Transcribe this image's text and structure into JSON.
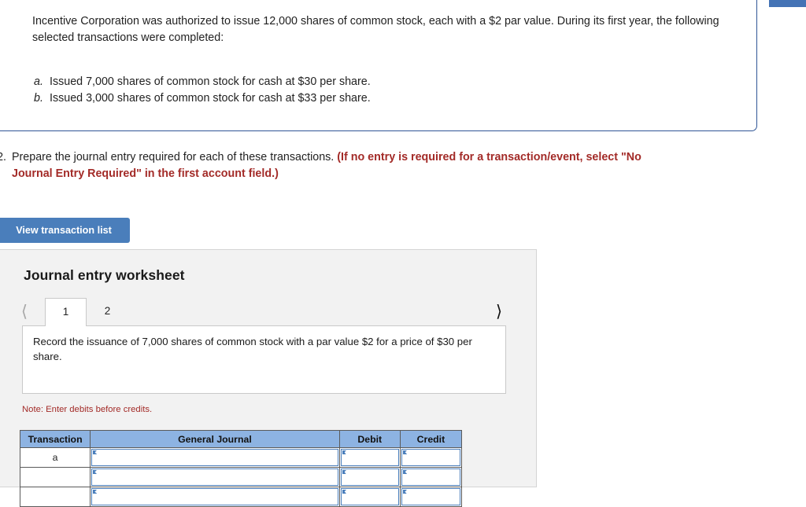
{
  "question": {
    "statement": "Incentive Corporation was authorized to issue 12,000 shares of common stock, each with a $2 par value. During its first year, the following selected transactions were completed:",
    "items": [
      {
        "marker": "a.",
        "text": "Issued 7,000 shares of common stock for cash at $30 per share."
      },
      {
        "marker": "b.",
        "text": "Issued 3,000 shares of common stock for cash at $33 per share."
      }
    ]
  },
  "requirement": {
    "number": "2.",
    "text": "Prepare the journal entry required for each of these transactions.",
    "emphasis_line1": "(If no entry is required for a transaction/event, select \"No",
    "emphasis_line2": "Journal Entry Required\" in the first account field.)"
  },
  "buttons": {
    "view_transaction_list": "View transaction list"
  },
  "worksheet": {
    "title": "Journal entry worksheet",
    "tabs": [
      {
        "label": "1",
        "active": true
      },
      {
        "label": "2",
        "active": false
      }
    ],
    "nav": {
      "prev_icon": "chevron-left-icon",
      "next_icon": "chevron-right-icon"
    },
    "record_prompt": "Record the issuance of 7,000 shares of common stock with a par value $2 for a price of $30 per share.",
    "note": "Note: Enter debits before credits.",
    "table": {
      "headers": [
        "Transaction",
        "General Journal",
        "Debit",
        "Credit"
      ],
      "rows": [
        {
          "transaction": "a",
          "general_journal": "",
          "debit": "",
          "credit": ""
        },
        {
          "transaction": "",
          "general_journal": "",
          "debit": "",
          "credit": ""
        },
        {
          "transaction": "",
          "general_journal": "",
          "debit": "",
          "credit": ""
        }
      ]
    }
  },
  "colors": {
    "accent_blue": "#4a7ebb",
    "header_blue": "#8db3e2",
    "border_blue": "#2f5596",
    "alert_red": "#a32b28",
    "panel_gray": "#f2f2f2"
  }
}
